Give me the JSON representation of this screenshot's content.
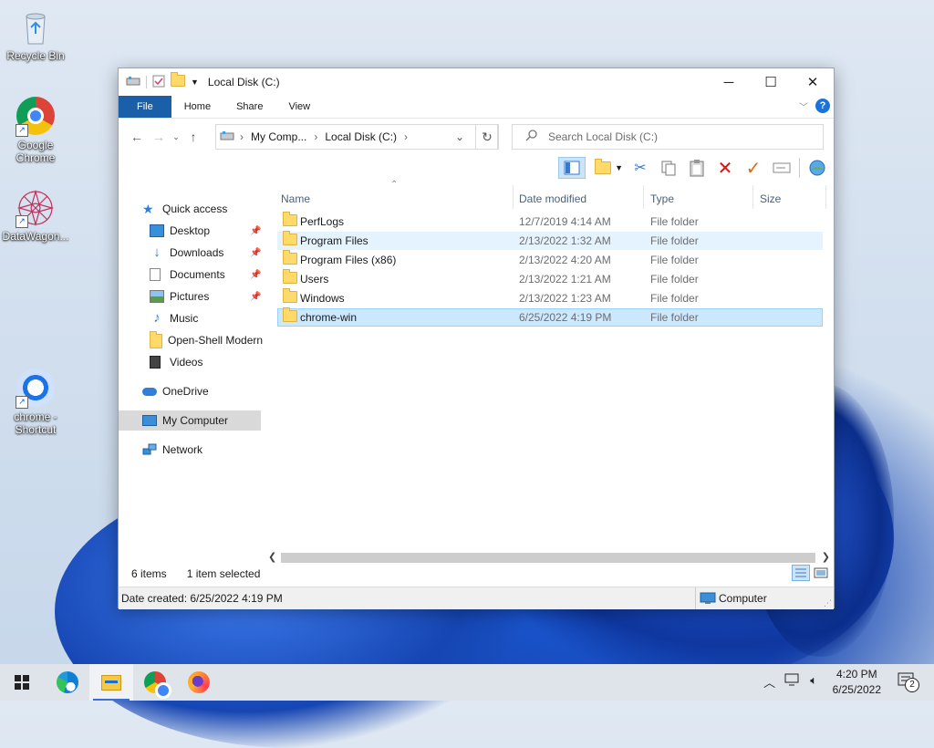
{
  "desktop": {
    "icons": [
      {
        "label": "Recycle Bin"
      },
      {
        "label": "Google Chrome"
      },
      {
        "label": "DataWagon..."
      },
      {
        "label": "chrome - Shortcut"
      }
    ]
  },
  "window": {
    "title": "Local Disk (C:)",
    "ribbon_tabs": [
      "File",
      "Home",
      "Share",
      "View"
    ],
    "help_label": "?",
    "address_path": [
      "My Comp...",
      "Local Disk (C:)"
    ],
    "search_placeholder": "Search Local Disk (C:)",
    "nav": {
      "quick_access": "Quick access",
      "pinned": [
        "Desktop",
        "Downloads",
        "Documents",
        "Pictures"
      ],
      "others": [
        "Music",
        "Open-Shell Modern",
        "Videos"
      ],
      "onedrive": "OneDrive",
      "my_computer": "My Computer",
      "network": "Network"
    },
    "columns": [
      "Name",
      "Date modified",
      "Type",
      "Size"
    ],
    "files": [
      {
        "name": "PerfLogs",
        "date": "12/7/2019 4:14 AM",
        "type": "File folder"
      },
      {
        "name": "Program Files",
        "date": "2/13/2022 1:32 AM",
        "type": "File folder"
      },
      {
        "name": "Program Files (x86)",
        "date": "2/13/2022 4:20 AM",
        "type": "File folder"
      },
      {
        "name": "Users",
        "date": "2/13/2022 1:21 AM",
        "type": "File folder"
      },
      {
        "name": "Windows",
        "date": "2/13/2022 1:23 AM",
        "type": "File folder"
      },
      {
        "name": "chrome-win",
        "date": "6/25/2022 4:19 PM",
        "type": "File folder"
      }
    ],
    "status": {
      "items": "6 items",
      "selected": "1 item selected"
    },
    "details": {
      "created": "Date created: 6/25/2022 4:19 PM",
      "location": "Computer"
    }
  },
  "taskbar": {
    "time": "4:20 PM",
    "date": "6/25/2022",
    "notification_count": "2"
  },
  "colors": {
    "accent": "#1a5fa8",
    "selection": "#cce8ff",
    "hover": "#e5f3ff"
  }
}
